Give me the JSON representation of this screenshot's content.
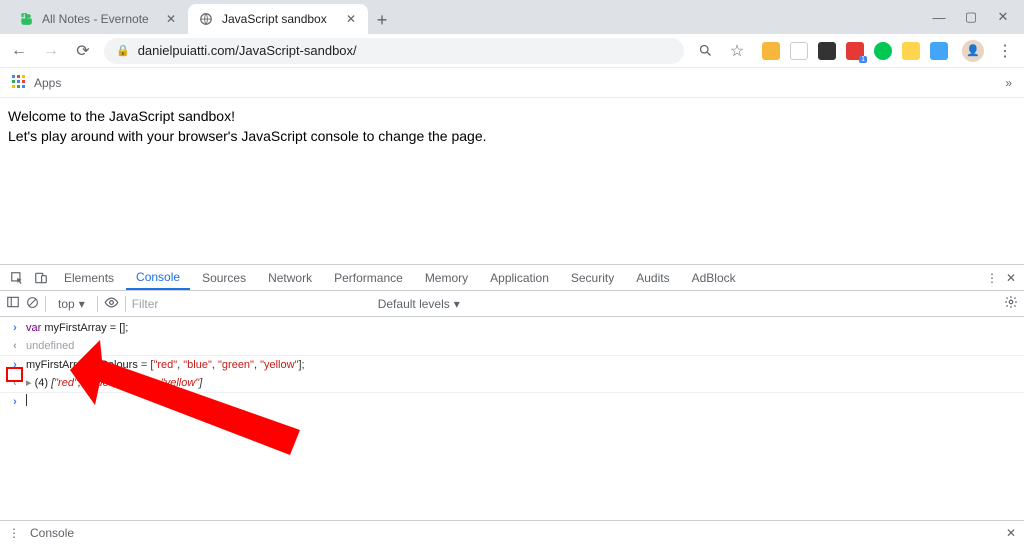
{
  "tabs": {
    "inactive": {
      "title": "All Notes - Evernote"
    },
    "active": {
      "title": "JavaScript sandbox"
    }
  },
  "addr": {
    "url": "danielpuiatti.com/JavaScript-sandbox/"
  },
  "bookmarks": {
    "apps": "Apps"
  },
  "page": {
    "line1": "Welcome to the JavaScript sandbox!",
    "line2": "Let's play around with your browser's JavaScript console to change the page."
  },
  "devtools": {
    "tabs": [
      "Elements",
      "Console",
      "Sources",
      "Network",
      "Performance",
      "Memory",
      "Application",
      "Security",
      "Audits",
      "AdBlock"
    ],
    "active_index": 1,
    "toolbar": {
      "context": "top",
      "filter_placeholder": "Filter",
      "levels": "Default levels"
    },
    "console": {
      "l1_kw": "var",
      "l1_rest": " myFirstArray = [];",
      "l2": "undefined",
      "l3_id": "myFirstArrayOfColours",
      "l3_rest_a": " = [",
      "l3_s1": "\"red\"",
      "l3_s2": "\"blue\"",
      "l3_s3": "\"green\"",
      "l3_s4": "\"yellow\"",
      "l3_rest_b": "];",
      "l4_count": "(4) ",
      "l4_open": "[",
      "l4_s1": "\"red\"",
      "l4_s2": "\"blue\"",
      "l4_s3": "\"green\"",
      "l4_s4": "\"yellow\"",
      "l4_close": "]",
      "comma": ", "
    },
    "drawer": "Console"
  }
}
